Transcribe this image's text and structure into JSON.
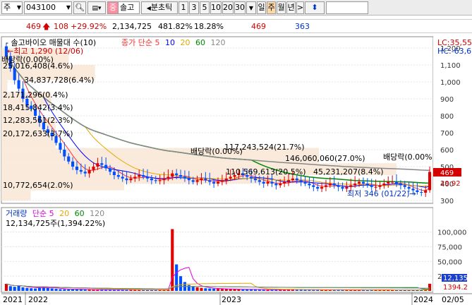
{
  "toolbar": {
    "market": "주",
    "code": "043100",
    "tag": "중",
    "name": "솔고",
    "split_label": "분초틱",
    "nums": [
      "1",
      "3",
      "5",
      "10",
      "20",
      "30"
    ],
    "periods": [
      "일",
      "주",
      "월",
      "년"
    ],
    "active_period": "주"
  },
  "pricebar": {
    "price": "469",
    "change": "108",
    "change_pct": "+29.92%",
    "volume": "2,134,725",
    "vol_ratio": "481.82%",
    "turnover": "18.28%",
    "prev_high": "469",
    "prev_low": "363"
  },
  "price_panel": {
    "legend_name": "솔고바이오 매물대 수(10)",
    "legend_ma_title": "종가 단순 5",
    "legend_ma_periods": [
      "10",
      "20",
      "60",
      "120"
    ],
    "legend_ma_colors": [
      "#ff3333",
      "#0000ff",
      "#e6a800",
      "#008800",
      "#888888"
    ],
    "lc_text": "LC:35,55",
    "hc_text": "HC:-63,6",
    "y_ticks": [
      "1,200",
      "1,100",
      "1,000",
      "900",
      "800",
      "700",
      "600",
      "500",
      "400",
      "300"
    ],
    "price_tag": "469",
    "pct_tag": "29.92",
    "high_label": "최고 1,290 (12/06)",
    "low_label": "최저 346 (01/22)",
    "div_label_1": "배당락(0.00%)",
    "div_label_2": "배당락(0.00%)",
    "div_label_3": "배당락(0.00%",
    "profile_labels": [
      "25,016,408(4.6%)",
      "34,837,728(6.4%)",
      "2,171,296(0.4%)",
      "18,415,842(3.4%)",
      "12,283,561(2.3%)",
      "20,172,633(3.7%)",
      "117,243,524(21.7%)",
      "146,060,060(27.0%)",
      "110,569,613(20.5%)",
      "45,231,207(8.4%)",
      "10,772,654(2.0%)"
    ]
  },
  "volume_panel": {
    "legend_name": "거래량",
    "legend_ma_title": "단순 5",
    "legend_ma_periods": [
      "20",
      "60",
      "120"
    ],
    "legend_ma_colors": [
      "#e000e0",
      "#e6a800",
      "#008800",
      "#888888"
    ],
    "info": "12,134,725주(1,394.22%)",
    "y_ticks": [
      "100,000",
      "75,000",
      "50,000",
      "25,000"
    ],
    "tag_value": "12,135",
    "tag_pct": "1394.2"
  },
  "xaxis": {
    "labels": [
      "2021",
      "2022",
      "2023",
      "2024",
      "02/05"
    ]
  },
  "colors": {
    "up": "#e00000",
    "down": "#0050ff",
    "profile": "#f8e8d8"
  },
  "chart_data": {
    "type": "candlestick",
    "interval": "weekly",
    "x_range": [
      "2021-12",
      "2024-02-05"
    ],
    "price_ylim": [
      300,
      1250
    ],
    "volume_ylim": [
      0,
      120000
    ],
    "last_price": 469,
    "last_change": 108,
    "last_change_pct": 29.92,
    "high": {
      "value": 1290,
      "date": "12/06"
    },
    "low": {
      "value": 346,
      "date": "01/22"
    },
    "close_approx": [
      1150,
      1080,
      1010,
      960,
      900,
      860,
      840,
      800,
      760,
      720,
      700,
      680,
      640,
      600,
      560,
      530,
      500,
      480,
      470,
      460,
      480,
      500,
      520,
      510,
      490,
      470,
      450,
      440,
      430,
      420,
      430,
      440,
      450,
      440,
      430,
      420,
      415,
      420,
      430,
      440,
      460,
      450,
      440,
      430,
      420,
      410,
      420,
      430,
      420,
      410,
      400,
      410,
      420,
      430,
      440,
      450,
      460,
      450,
      440,
      430,
      420,
      410,
      400,
      410,
      400,
      390,
      400,
      410,
      420,
      430,
      420,
      410,
      400,
      390,
      380,
      370,
      380,
      390,
      400,
      390,
      380,
      370,
      380,
      390,
      400,
      410,
      400,
      390,
      380,
      380,
      390,
      400,
      410,
      410,
      400,
      390,
      380,
      370,
      360,
      350,
      346,
      361,
      469
    ],
    "volume_approx": [
      12000,
      8000,
      7000,
      9000,
      6000,
      5000,
      4500,
      4000,
      6000,
      7000,
      5000,
      4000,
      3500,
      3000,
      2800,
      2600,
      3000,
      3200,
      2500,
      2200,
      2000,
      1800,
      2100,
      2500,
      2300,
      2000,
      1800,
      1900,
      2100,
      2400,
      2000,
      1800,
      1700,
      1600,
      1800,
      2000,
      2200,
      2000,
      1900,
      2100,
      105000,
      45000,
      25000,
      15000,
      10000,
      8000,
      6000,
      5000,
      4500,
      4000,
      3800,
      3500,
      3300,
      3000,
      2900,
      2800,
      2700,
      2600,
      2500,
      2400,
      2300,
      2200,
      2100,
      2000,
      2100,
      2200,
      2300,
      2400,
      2500,
      2400,
      2300,
      2200,
      2100,
      2000,
      1900,
      1800,
      1900,
      2000,
      2100,
      2000,
      1900,
      1800,
      1700,
      1600,
      1700,
      1800,
      1900,
      2000,
      2100,
      2000,
      1900,
      1800,
      1700,
      1600,
      1500,
      1600,
      1700,
      1800,
      1900,
      2000,
      2100,
      2200,
      12135
    ]
  }
}
